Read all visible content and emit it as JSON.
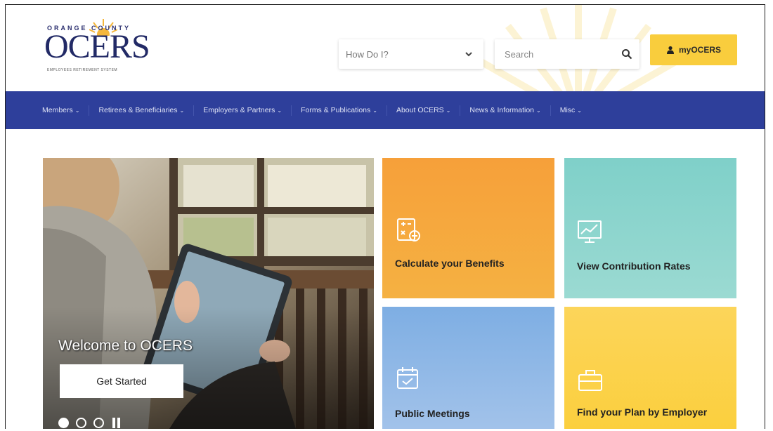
{
  "header": {
    "logo": {
      "top_text": "ORANGE COUNTY",
      "main_text": "OCERS",
      "sub_text": "EMPLOYEES RETIREMENT SYSTEM"
    },
    "how_do_i": {
      "label": "How Do I?",
      "icon": "chevron-down-icon"
    },
    "search": {
      "placeholder": "Search",
      "icon": "search-icon"
    },
    "my_button": {
      "label": "myOCERS",
      "icon": "user-icon"
    }
  },
  "nav": {
    "items": [
      {
        "label": "Members"
      },
      {
        "label": "Retirees & Beneficiaries"
      },
      {
        "label": "Employers & Partners"
      },
      {
        "label": "Forms & Publications"
      },
      {
        "label": "About OCERS"
      },
      {
        "label": "News & Information"
      },
      {
        "label": "Misc"
      }
    ],
    "caret": "⌄"
  },
  "hero": {
    "headline": "Welcome to OCERS",
    "button_label": "Get Started",
    "slides": {
      "count": 3,
      "active_index": 0
    }
  },
  "tiles": [
    {
      "label": "Calculate your Benefits",
      "icon": "calculator-icon",
      "color": "#f6a83c"
    },
    {
      "label": "View Contribution Rates",
      "icon": "chart-line-icon",
      "color": "#8cd5cd"
    },
    {
      "label": "Public Meetings",
      "icon": "calendar-icon",
      "color": "#8ab6e6"
    },
    {
      "label": "Find your Plan by Employer",
      "icon": "briefcase-icon",
      "color": "#fbd24a"
    }
  ],
  "colors": {
    "nav_bg": "#2e3f9b",
    "accent_yellow": "#f9cd3d",
    "logo_blue": "#222a66"
  }
}
